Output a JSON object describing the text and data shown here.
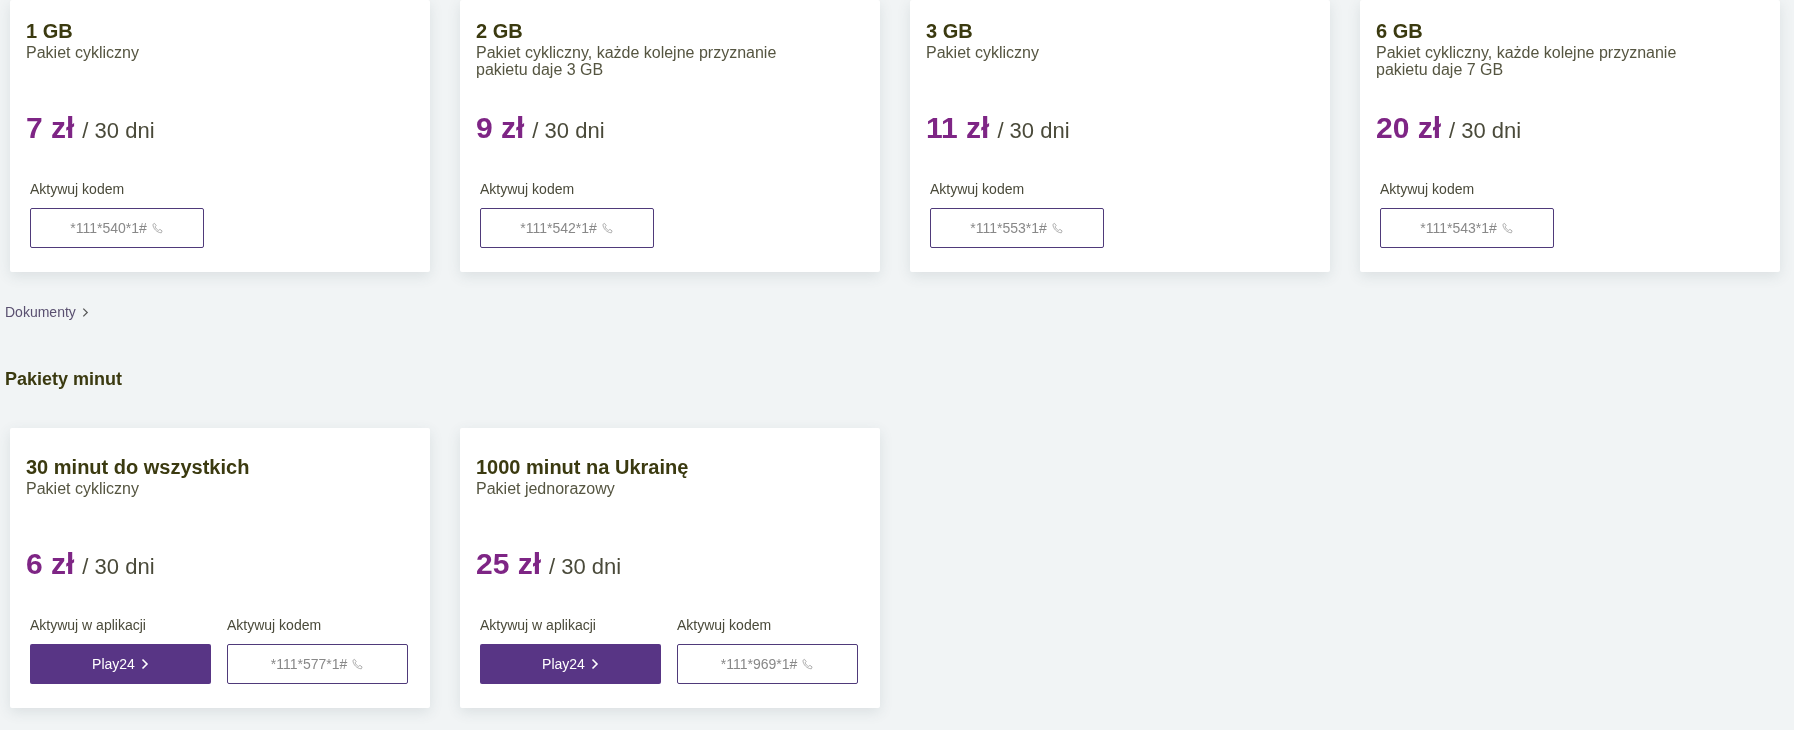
{
  "data_packages": [
    {
      "title": "1 GB",
      "subtitle": "Pakiet cykliczny",
      "price": "7 zł",
      "period": "/ 30 dni",
      "activations": [
        {
          "kind": "code",
          "label": "Aktywuj kodem",
          "code": "*111*540*1#"
        }
      ]
    },
    {
      "title": "2 GB",
      "subtitle": "Pakiet cykliczny, każde kolejne przyznanie pakietu daje 3 GB",
      "price": "9 zł",
      "period": "/ 30 dni",
      "activations": [
        {
          "kind": "code",
          "label": "Aktywuj kodem",
          "code": "*111*542*1#"
        }
      ]
    },
    {
      "title": "3 GB",
      "subtitle": "Pakiet cykliczny",
      "price": "11 zł",
      "period": "/ 30 dni",
      "activations": [
        {
          "kind": "code",
          "label": "Aktywuj kodem",
          "code": "*111*553*1#"
        }
      ]
    },
    {
      "title": "6 GB",
      "subtitle": "Pakiet cykliczny, każde kolejne przyznanie pakietu daje 7 GB",
      "price": "20 zł",
      "period": "/ 30 dni",
      "activations": [
        {
          "kind": "code",
          "label": "Aktywuj kodem",
          "code": "*111*543*1#"
        }
      ]
    }
  ],
  "documents_link": "Dokumenty",
  "minutes_section": {
    "heading": "Pakiety minut",
    "packages": [
      {
        "title": "30 minut do wszystkich",
        "subtitle": "Pakiet cykliczny",
        "price": "6 zł",
        "period": "/ 30 dni",
        "activations": [
          {
            "kind": "app",
            "label": "Aktywuj w aplikacji",
            "button": "Play24"
          },
          {
            "kind": "code",
            "label": "Aktywuj kodem",
            "code": "*111*577*1#"
          }
        ]
      },
      {
        "title": "1000 minut na Ukrainę",
        "subtitle": "Pakiet jednorazowy",
        "price": "25 zł",
        "period": "/ 30 dni",
        "activations": [
          {
            "kind": "app",
            "label": "Aktywuj w aplikacji",
            "button": "Play24"
          },
          {
            "kind": "code",
            "label": "Aktywuj kodem",
            "code": "*111*969*1#"
          }
        ]
      }
    ]
  }
}
